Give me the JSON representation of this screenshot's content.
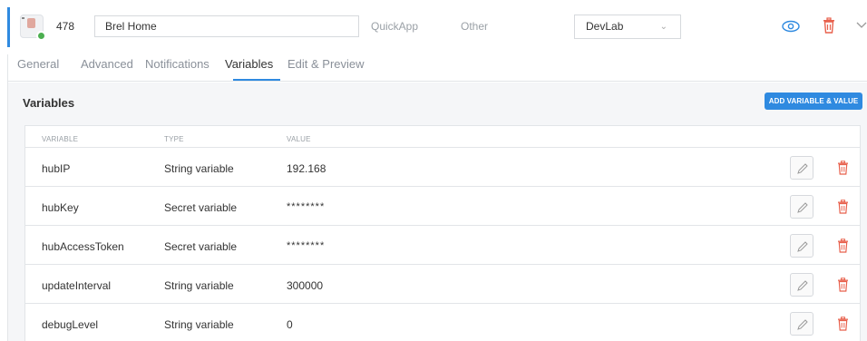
{
  "device": {
    "id": "478",
    "name": "Brel Home",
    "type": "QuickApp",
    "category": "Other",
    "room": "DevLab"
  },
  "icons": {
    "device": "device-thumbnail-icon",
    "visibility": "eye-icon",
    "delete": "trash-icon",
    "expand": "chevron-down-icon",
    "edit": "pencil-icon"
  },
  "colors": {
    "accent": "#2f8ae0",
    "danger": "#e8604c",
    "online": "#4caf50"
  },
  "tabs": [
    {
      "label": "General"
    },
    {
      "label": "Advanced"
    },
    {
      "label": "Notifications"
    },
    {
      "label": "Variables"
    },
    {
      "label": "Edit & Preview"
    }
  ],
  "active_tab": "Variables",
  "variables_section": {
    "title": "Variables",
    "add_button": "ADD VARIABLE & VALUE",
    "columns": [
      "VARIABLE",
      "TYPE",
      "VALUE"
    ],
    "rows": [
      {
        "name": "hubIP",
        "type": "String variable",
        "value": "192.168"
      },
      {
        "name": "hubKey",
        "type": "Secret variable",
        "value": "********"
      },
      {
        "name": "hubAccessToken",
        "type": "Secret variable",
        "value": "********"
      },
      {
        "name": "updateInterval",
        "type": "String variable",
        "value": "300000"
      },
      {
        "name": "debugLevel",
        "type": "String variable",
        "value": "0"
      }
    ]
  }
}
